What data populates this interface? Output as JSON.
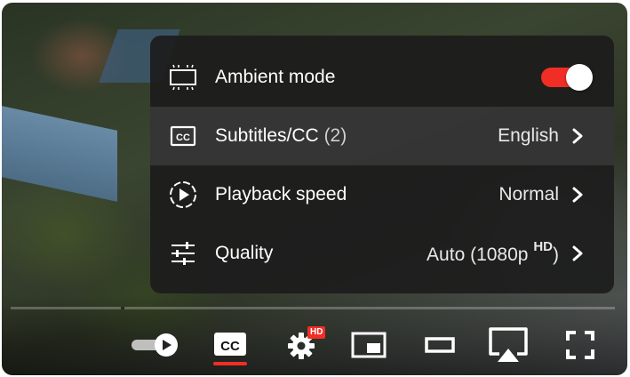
{
  "settings_menu": {
    "items": [
      {
        "icon": "ambient-mode-icon",
        "label": "Ambient mode",
        "toggle_on": true
      },
      {
        "icon": "subtitles-cc-icon",
        "label": "Subtitles/CC",
        "count": "(2)",
        "value": "English"
      },
      {
        "icon": "playback-speed-icon",
        "label": "Playback speed",
        "value": "Normal"
      },
      {
        "icon": "quality-sliders-icon",
        "label": "Quality",
        "value": "Auto (1080p",
        "value_badge": "HD",
        "value_suffix": ")"
      }
    ]
  },
  "controls": {
    "autoplay_on": true,
    "cc_label": "CC",
    "cc_active": true,
    "settings_badge": "HD"
  },
  "colors": {
    "accent": "#f12e25",
    "panel": "#1c1c1c"
  }
}
